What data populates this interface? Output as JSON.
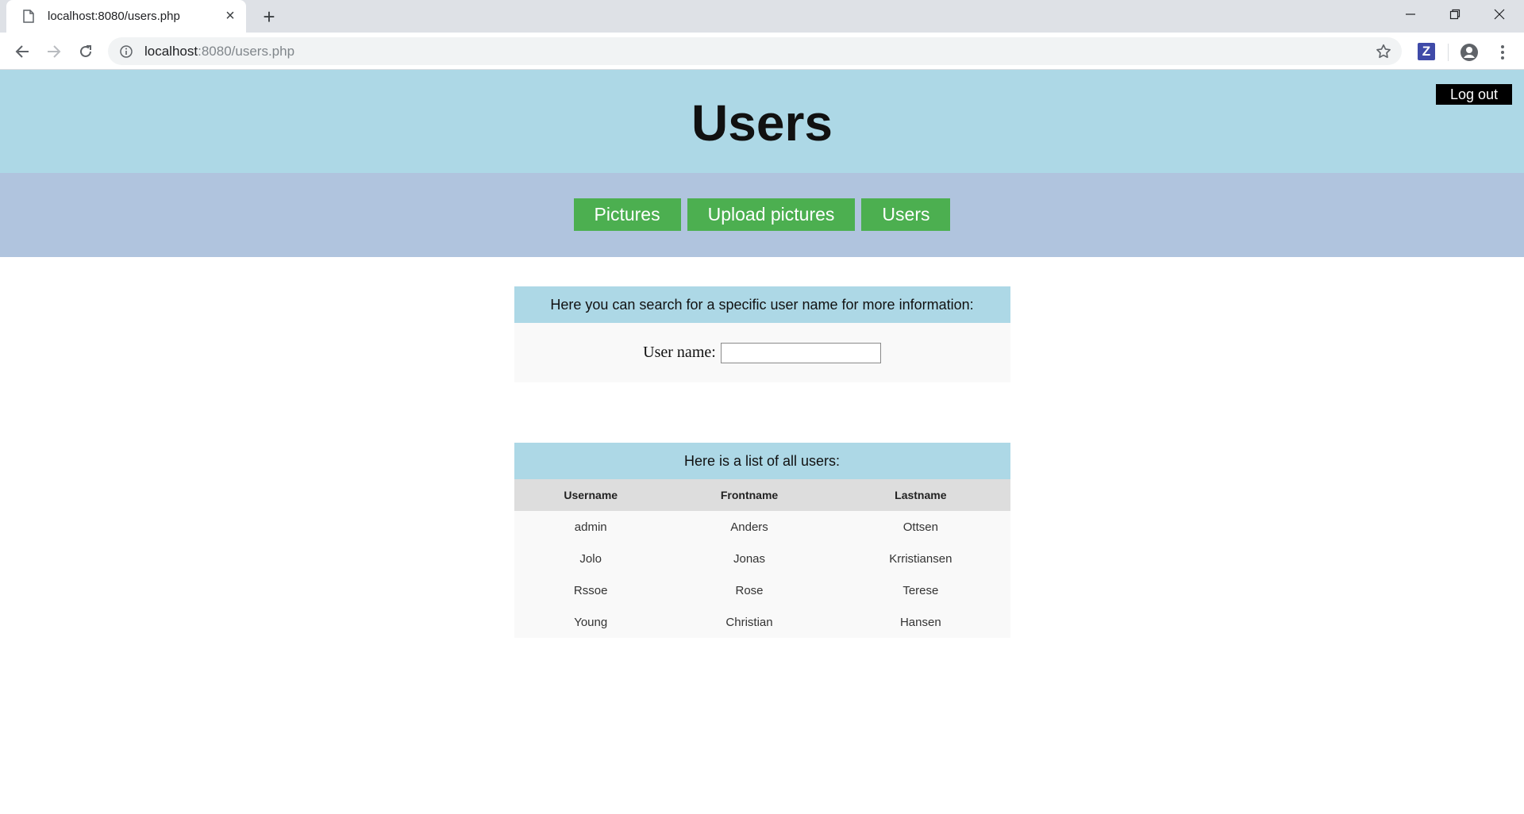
{
  "browser": {
    "tab_title": "localhost:8080/users.php",
    "url_host": "localhost",
    "url_rest": ":8080/users.php",
    "extension_letter": "Z"
  },
  "header": {
    "title": "Users",
    "logout_label": "Log out"
  },
  "nav": {
    "items": [
      "Pictures",
      "Upload pictures",
      "Users"
    ],
    "button_color": "#4caf50"
  },
  "search": {
    "heading": "Here you can search for a specific user name for more information:",
    "label": "User name:",
    "value": ""
  },
  "users": {
    "heading": "Here is a list of all users:",
    "columns": [
      "Username",
      "Frontname",
      "Lastname"
    ],
    "rows": [
      [
        "admin",
        "Anders",
        "Ottsen"
      ],
      [
        "Jolo",
        "Jonas",
        "Krristiansen"
      ],
      [
        "Rssoe",
        "Rose",
        "Terese"
      ],
      [
        "Young",
        "Christian",
        "Hansen"
      ]
    ]
  },
  "colors": {
    "header_bg": "#add8e6",
    "nav_bg": "#b0c4de",
    "logout_bg": "#000000"
  }
}
